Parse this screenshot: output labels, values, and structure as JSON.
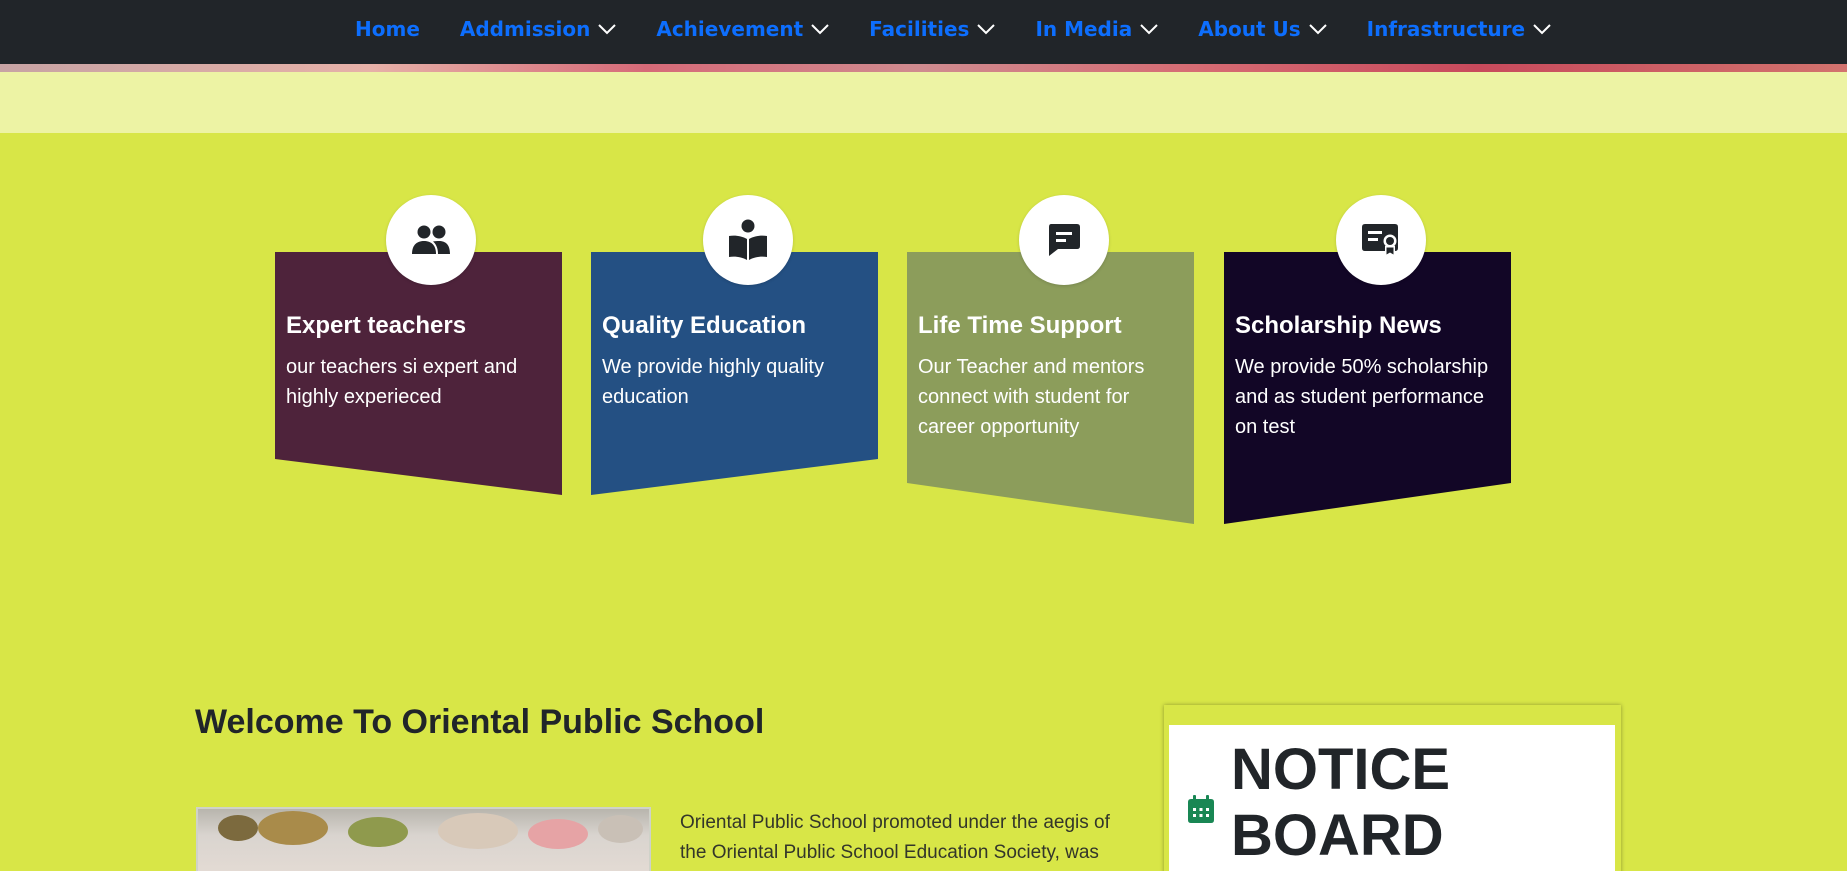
{
  "navbar": {
    "items": [
      {
        "label": "Home",
        "dropdown": false
      },
      {
        "label": "Addmission",
        "dropdown": true
      },
      {
        "label": "Achievement",
        "dropdown": true
      },
      {
        "label": "Facilities",
        "dropdown": true
      },
      {
        "label": "In Media",
        "dropdown": true
      },
      {
        "label": "About Us",
        "dropdown": true
      },
      {
        "label": "Infrastructure",
        "dropdown": true
      }
    ],
    "link_color": "#0d6efd",
    "background": "#212529"
  },
  "features": [
    {
      "title": "Expert teachers",
      "text": "our teachers si expert and highly experieced",
      "color": "#4e233b",
      "icon": "users-icon"
    },
    {
      "title": "Quality Education",
      "text": "We provide highly quality education",
      "color": "#245083",
      "icon": "book-reader-icon"
    },
    {
      "title": "Life Time Support",
      "text": "Our Teacher and mentors connect with student for career opportunity",
      "color": "#8c9d5b",
      "icon": "message-icon"
    },
    {
      "title": "Scholarship News",
      "text": "We provide 50% scholarship and as student performance on test",
      "color": "#120626",
      "icon": "certificate-icon"
    }
  ],
  "welcome": {
    "title": "Welcome To Oriental Public School",
    "text": "Oriental Public School promoted under the aegis of the Oriental Public School Education Society, was"
  },
  "notice": {
    "title": "NOTICE BOARD",
    "icon": "calendar-icon",
    "icon_color": "#198754"
  },
  "colors": {
    "page_background": "#d8e647",
    "pale_band": "#edf3a4"
  }
}
